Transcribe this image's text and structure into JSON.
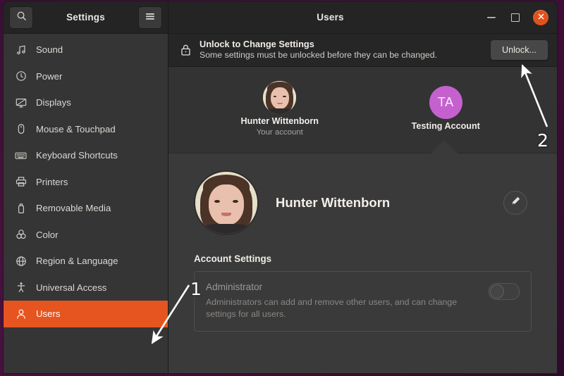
{
  "window": {
    "sidebar_title": "Settings",
    "title": "Users",
    "search_icon": "search-icon",
    "menu_icon": "hamburger-menu-icon",
    "minimize_label": "–",
    "maximize_label": "",
    "close_label": "✕",
    "accent_orange": "#e6551f",
    "close_button_color": "#e0521d"
  },
  "sidebar": {
    "items": [
      {
        "label": "Sound",
        "icon": "music-note-icon",
        "active": false
      },
      {
        "label": "Power",
        "icon": "power-clock-icon",
        "active": false
      },
      {
        "label": "Displays",
        "icon": "monitor-icon",
        "active": false
      },
      {
        "label": "Mouse & Touchpad",
        "icon": "mouse-icon",
        "active": false
      },
      {
        "label": "Keyboard Shortcuts",
        "icon": "keyboard-icon",
        "active": false
      },
      {
        "label": "Printers",
        "icon": "printer-icon",
        "active": false
      },
      {
        "label": "Removable Media",
        "icon": "usb-drive-icon",
        "active": false
      },
      {
        "label": "Color",
        "icon": "color-circles-icon",
        "active": false
      },
      {
        "label": "Region & Language",
        "icon": "globe-icon",
        "active": false
      },
      {
        "label": "Universal Access",
        "icon": "accessibility-icon",
        "active": false
      },
      {
        "label": "Users",
        "icon": "user-icon",
        "active": true
      }
    ]
  },
  "infobar": {
    "lock_icon": "lock-closed-icon",
    "title": "Unlock to Change Settings",
    "subtitle": "Some settings must be unlocked before they can be changed.",
    "unlock_button": "Unlock..."
  },
  "carousel": {
    "users": [
      {
        "name": "Hunter Wittenborn",
        "subtitle": "Your account",
        "avatar_type": "photo",
        "initials": "",
        "selected": true
      },
      {
        "name": "Testing Account",
        "subtitle": "",
        "avatar_type": "initials",
        "initials": "TA",
        "avatar_color": "#c561cf",
        "selected": false
      }
    ]
  },
  "detail": {
    "user_name": "Hunter Wittenborn",
    "edit_icon": "pencil-edit-icon",
    "section_title": "Account Settings",
    "administrator": {
      "label": "Administrator",
      "description": "Administrators can add and remove other users, and can change settings for all users.",
      "toggle_state": "off"
    }
  },
  "annotations": [
    {
      "id": "1",
      "label": "1",
      "points_to": "sidebar-item-users"
    },
    {
      "id": "2",
      "label": "2",
      "points_to": "unlock-button"
    }
  ]
}
